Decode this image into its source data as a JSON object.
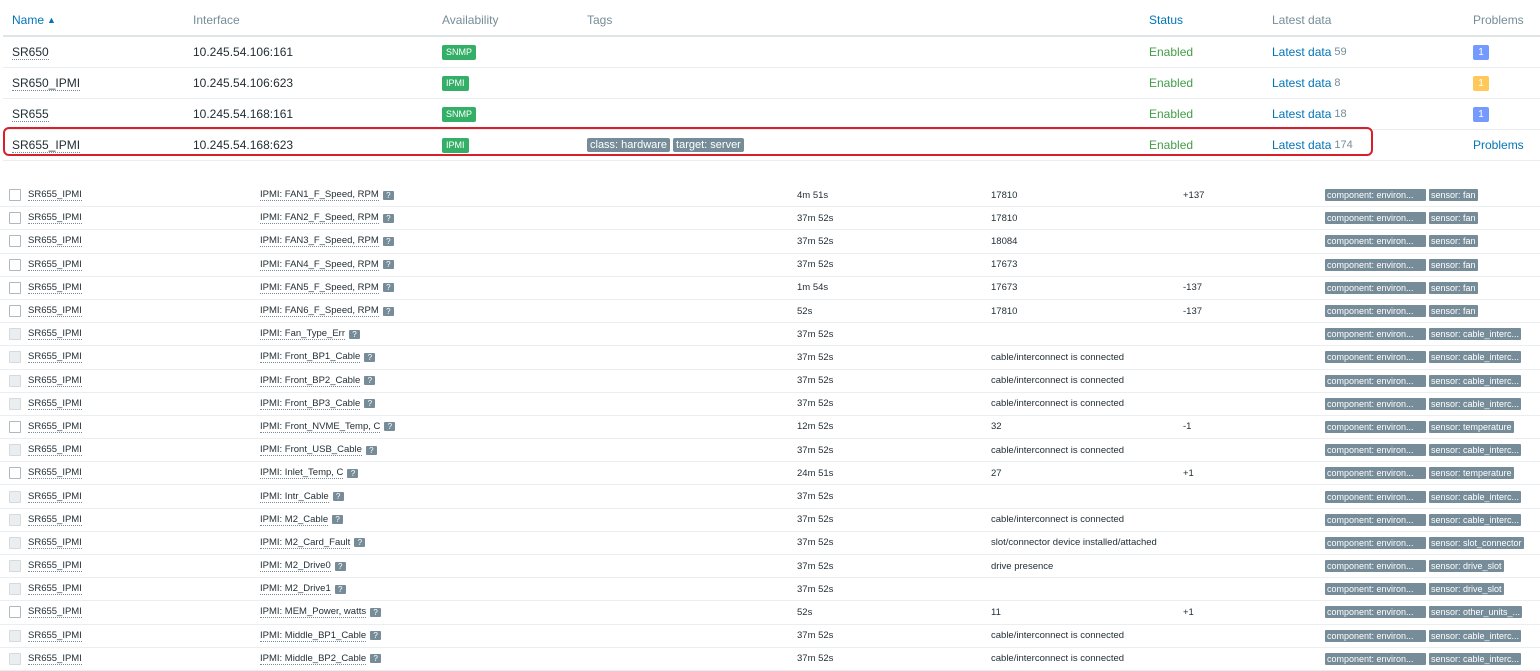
{
  "hosts_table": {
    "columns": {
      "name": "Name",
      "interface": "Interface",
      "availability": "Availability",
      "tags": "Tags",
      "status": "Status",
      "latest_data": "Latest data",
      "problems": "Problems"
    },
    "sort_indicator": "▲",
    "rows": [
      {
        "name": "SR650",
        "interface": "10.245.54.106:161",
        "availability": "SNMP",
        "tags": [],
        "status": "Enabled",
        "latest_label": "Latest data",
        "latest_count": "59",
        "problems": "1",
        "problem_severity": "info"
      },
      {
        "name": "SR650_IPMI",
        "interface": "10.245.54.106:623",
        "availability": "IPMI",
        "tags": [],
        "status": "Enabled",
        "latest_label": "Latest data",
        "latest_count": "8",
        "problems": "1",
        "problem_severity": "warning"
      },
      {
        "name": "SR655",
        "interface": "10.245.54.168:161",
        "availability": "SNMP",
        "tags": [],
        "status": "Enabled",
        "latest_label": "Latest data",
        "latest_count": "18",
        "problems": "1",
        "problem_severity": "info"
      },
      {
        "name": "SR655_IPMI",
        "interface": "10.245.54.168:623",
        "availability": "IPMI",
        "tags": [
          "class: hardware",
          "target: server"
        ],
        "status": "Enabled",
        "latest_label": "Latest data",
        "latest_count": "174",
        "problems": "Problems",
        "problem_severity": "link"
      }
    ]
  },
  "items_table": {
    "rows": [
      {
        "host": "SR655_IPMI",
        "name": "IPMI: FAN1_F_Speed, RPM",
        "last_check": "4m 51s",
        "last_value": "17810",
        "change": "+137",
        "tags": [
          "component: environ...",
          "sensor: fan"
        ],
        "checkbox_enabled": true
      },
      {
        "host": "SR655_IPMI",
        "name": "IPMI: FAN2_F_Speed, RPM",
        "last_check": "37m 52s",
        "last_value": "17810",
        "change": "",
        "tags": [
          "component: environ...",
          "sensor: fan"
        ],
        "checkbox_enabled": true
      },
      {
        "host": "SR655_IPMI",
        "name": "IPMI: FAN3_F_Speed, RPM",
        "last_check": "37m 52s",
        "last_value": "18084",
        "change": "",
        "tags": [
          "component: environ...",
          "sensor: fan"
        ],
        "checkbox_enabled": true
      },
      {
        "host": "SR655_IPMI",
        "name": "IPMI: FAN4_F_Speed, RPM",
        "last_check": "37m 52s",
        "last_value": "17673",
        "change": "",
        "tags": [
          "component: environ...",
          "sensor: fan"
        ],
        "checkbox_enabled": true
      },
      {
        "host": "SR655_IPMI",
        "name": "IPMI: FAN5_F_Speed, RPM",
        "last_check": "1m 54s",
        "last_value": "17673",
        "change": "-137",
        "tags": [
          "component: environ...",
          "sensor: fan"
        ],
        "checkbox_enabled": true
      },
      {
        "host": "SR655_IPMI",
        "name": "IPMI: FAN6_F_Speed, RPM",
        "last_check": "52s",
        "last_value": "17810",
        "change": "-137",
        "tags": [
          "component: environ...",
          "sensor: fan"
        ],
        "checkbox_enabled": true
      },
      {
        "host": "SR655_IPMI",
        "name": "IPMI: Fan_Type_Err",
        "last_check": "37m 52s",
        "last_value": "",
        "change": "",
        "tags": [
          "component: environ...",
          "sensor: cable_interc..."
        ],
        "checkbox_enabled": false
      },
      {
        "host": "SR655_IPMI",
        "name": "IPMI: Front_BP1_Cable",
        "last_check": "37m 52s",
        "last_value": "cable/interconnect is connected",
        "change": "",
        "tags": [
          "component: environ...",
          "sensor: cable_interc..."
        ],
        "checkbox_enabled": false
      },
      {
        "host": "SR655_IPMI",
        "name": "IPMI: Front_BP2_Cable",
        "last_check": "37m 52s",
        "last_value": "cable/interconnect is connected",
        "change": "",
        "tags": [
          "component: environ...",
          "sensor: cable_interc..."
        ],
        "checkbox_enabled": false
      },
      {
        "host": "SR655_IPMI",
        "name": "IPMI: Front_BP3_Cable",
        "last_check": "37m 52s",
        "last_value": "cable/interconnect is connected",
        "change": "",
        "tags": [
          "component: environ...",
          "sensor: cable_interc..."
        ],
        "checkbox_enabled": false
      },
      {
        "host": "SR655_IPMI",
        "name": "IPMI: Front_NVME_Temp, C",
        "last_check": "12m 52s",
        "last_value": "32",
        "change": "-1",
        "tags": [
          "component: environ...",
          "sensor: temperature"
        ],
        "checkbox_enabled": true
      },
      {
        "host": "SR655_IPMI",
        "name": "IPMI: Front_USB_Cable",
        "last_check": "37m 52s",
        "last_value": "cable/interconnect is connected",
        "change": "",
        "tags": [
          "component: environ...",
          "sensor: cable_interc..."
        ],
        "checkbox_enabled": false
      },
      {
        "host": "SR655_IPMI",
        "name": "IPMI: Inlet_Temp, C",
        "last_check": "24m 51s",
        "last_value": "27",
        "change": "+1",
        "tags": [
          "component: environ...",
          "sensor: temperature"
        ],
        "checkbox_enabled": true
      },
      {
        "host": "SR655_IPMI",
        "name": "IPMI: Intr_Cable",
        "last_check": "37m 52s",
        "last_value": "",
        "change": "",
        "tags": [
          "component: environ...",
          "sensor: cable_interc..."
        ],
        "checkbox_enabled": false
      },
      {
        "host": "SR655_IPMI",
        "name": "IPMI: M2_Cable",
        "last_check": "37m 52s",
        "last_value": "cable/interconnect is connected",
        "change": "",
        "tags": [
          "component: environ...",
          "sensor: cable_interc..."
        ],
        "checkbox_enabled": false
      },
      {
        "host": "SR655_IPMI",
        "name": "IPMI: M2_Card_Fault",
        "last_check": "37m 52s",
        "last_value": "slot/connector device installed/attached",
        "change": "",
        "tags": [
          "component: environ...",
          "sensor: slot_connector"
        ],
        "checkbox_enabled": false
      },
      {
        "host": "SR655_IPMI",
        "name": "IPMI: M2_Drive0",
        "last_check": "37m 52s",
        "last_value": "drive presence",
        "change": "",
        "tags": [
          "component: environ...",
          "sensor: drive_slot"
        ],
        "checkbox_enabled": false
      },
      {
        "host": "SR655_IPMI",
        "name": "IPMI: M2_Drive1",
        "last_check": "37m 52s",
        "last_value": "",
        "change": "",
        "tags": [
          "component: environ...",
          "sensor: drive_slot"
        ],
        "checkbox_enabled": false
      },
      {
        "host": "SR655_IPMI",
        "name": "IPMI: MEM_Power, watts",
        "last_check": "52s",
        "last_value": "11",
        "change": "+1",
        "tags": [
          "component: environ...",
          "sensor: other_units_..."
        ],
        "checkbox_enabled": true
      },
      {
        "host": "SR655_IPMI",
        "name": "IPMI: Middle_BP1_Cable",
        "last_check": "37m 52s",
        "last_value": "cable/interconnect is connected",
        "change": "",
        "tags": [
          "component: environ...",
          "sensor: cable_interc..."
        ],
        "checkbox_enabled": false
      },
      {
        "host": "SR655_IPMI",
        "name": "IPMI: Middle_BP2_Cable",
        "last_check": "37m 52s",
        "last_value": "cable/interconnect is connected",
        "change": "",
        "tags": [
          "component: environ...",
          "sensor: cable_interc..."
        ],
        "checkbox_enabled": false
      }
    ]
  },
  "help_icon_glyph": "?",
  "colors": {
    "link": "#0275b8",
    "enabled": "#429e47",
    "availability_badge": "#34af67",
    "problem_info": "#7499ff",
    "problem_warning": "#ffc859",
    "tag": "#768d99",
    "highlight_box": "#d8202a"
  }
}
